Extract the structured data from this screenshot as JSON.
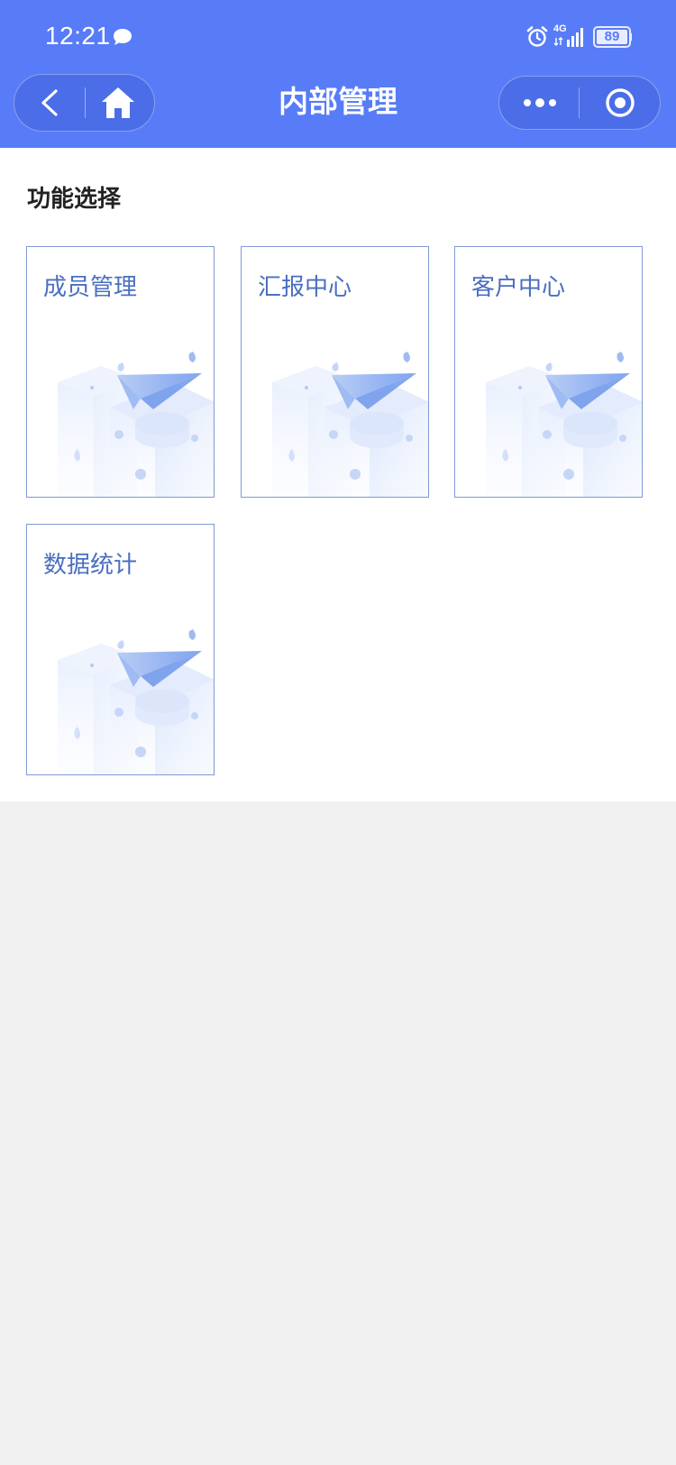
{
  "status_bar": {
    "time": "12:21",
    "network": "4G",
    "battery": "89",
    "icons": [
      "chat-bubble-icon",
      "alarm-icon",
      "signal-icon",
      "battery-icon"
    ]
  },
  "nav": {
    "title": "内部管理",
    "back_icon": "chevron-left-icon",
    "home_icon": "home-icon",
    "more_icon": "more-dots-icon",
    "close_icon": "target-circle-icon"
  },
  "main": {
    "section_title": "功能选择",
    "cards": [
      {
        "label": "成员管理",
        "illustration": "paper-plane-blocks-illustration"
      },
      {
        "label": "汇报中心",
        "illustration": "paper-plane-blocks-illustration"
      },
      {
        "label": "客户中心",
        "illustration": "paper-plane-blocks-illustration"
      },
      {
        "label": "数据统计",
        "illustration": "paper-plane-blocks-illustration"
      }
    ]
  },
  "colors": {
    "header_bg": "#587cf7",
    "card_border": "#7f9ad4",
    "card_text": "#4a6fc0",
    "page_bg": "#f0f0f0"
  }
}
